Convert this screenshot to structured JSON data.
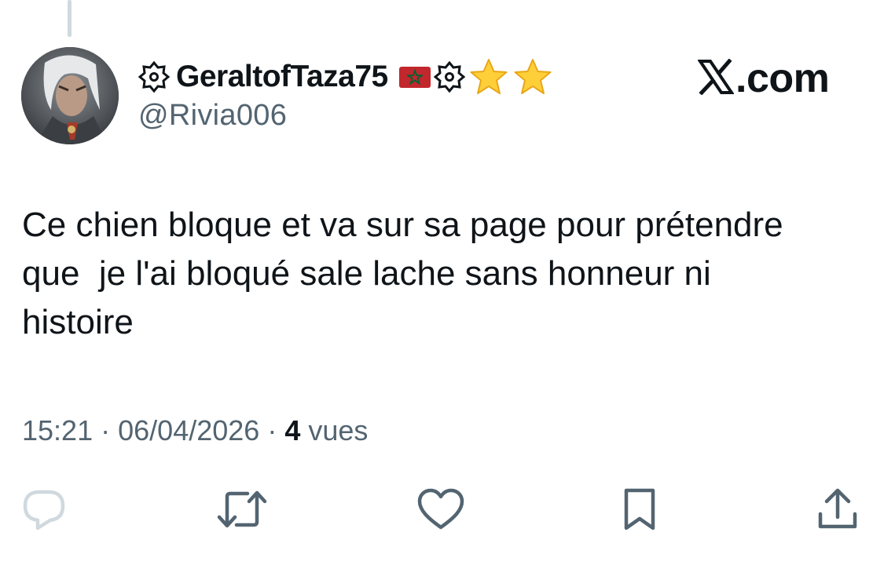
{
  "tweet": {
    "display_name": "GeraltofTaza75",
    "handle": "@Rivia006",
    "brand": ".com",
    "brand_icon": "x-logo-icon",
    "name_decorations": [
      "badge-icon",
      "morocco-flag-icon",
      "badge-icon",
      "star-icon",
      "star-icon"
    ],
    "text": "Ce chien bloque et va sur sa page pour prétendre\nque  je l'ai bloqué sale lache sans honneur ni\nhistoire",
    "time": "15:21",
    "date": "06/04/2026",
    "separator": "·",
    "views_count": "4",
    "views_label": "vues"
  },
  "actions": [
    {
      "name": "reply-icon"
    },
    {
      "name": "retweet-icon"
    },
    {
      "name": "like-icon"
    },
    {
      "name": "bookmark-icon"
    },
    {
      "name": "share-icon"
    }
  ],
  "colors": {
    "text_primary": "#0f1419",
    "text_secondary": "#536471",
    "icon_gray": "#536471",
    "reply_icon_gray": "#cfd9de",
    "thread_line": "#cfd9de",
    "flag_red": "#c1272d",
    "flag_green": "#006233",
    "star_yellow": "#ffcf3a"
  }
}
